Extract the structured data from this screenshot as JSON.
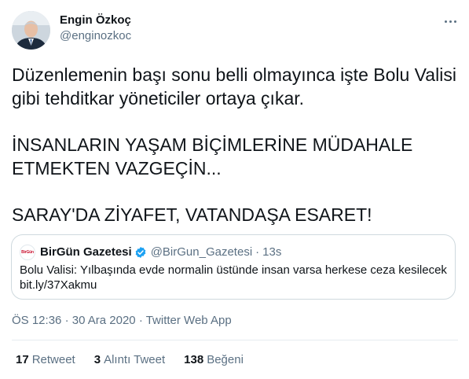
{
  "author": {
    "name": "Engin Özkoç",
    "handle": "@enginozkoc"
  },
  "tweet": {
    "lines": [
      "Düzenlemenin başı sonu belli olmayınca işte Bolu Valisi",
      "gibi tehditkar yöneticiler ortaya çıkar.",
      "İNSANLARIN YAŞAM BİÇİMLERİNE MÜDAHALE",
      "ETMEKTEN VAZGEÇİN...",
      "SARAY'DA ZİYAFET, VATANDAŞA ESARET!"
    ]
  },
  "quoted": {
    "avatar_text": "BirGün",
    "name": "BirGün Gazetesi",
    "handle": "@BirGun_Gazetesi",
    "separator": "·",
    "time": "13s",
    "text_line1": "Bolu Valisi: Yılbaşında evde normalin üstünde insan varsa herkese ceza kesilecek",
    "text_line2": "bit.ly/37Xakmu"
  },
  "meta": {
    "time": "ÖS 12:36",
    "date": "30 Ara 2020",
    "source": "Twitter Web App",
    "separator": "·"
  },
  "stats": {
    "retweets": "17",
    "retweets_label": "Retweet",
    "quotes": "3",
    "quotes_label": "Alıntı Tweet",
    "likes": "138",
    "likes_label": "Beğeni"
  },
  "colors": {
    "text": "#0f1419",
    "secondary": "#5b7083",
    "verified": "#1da1f2",
    "border": "#cfd9de"
  },
  "icons": {
    "more": "more-horizontal-icon",
    "verified": "verified-badge-icon"
  }
}
